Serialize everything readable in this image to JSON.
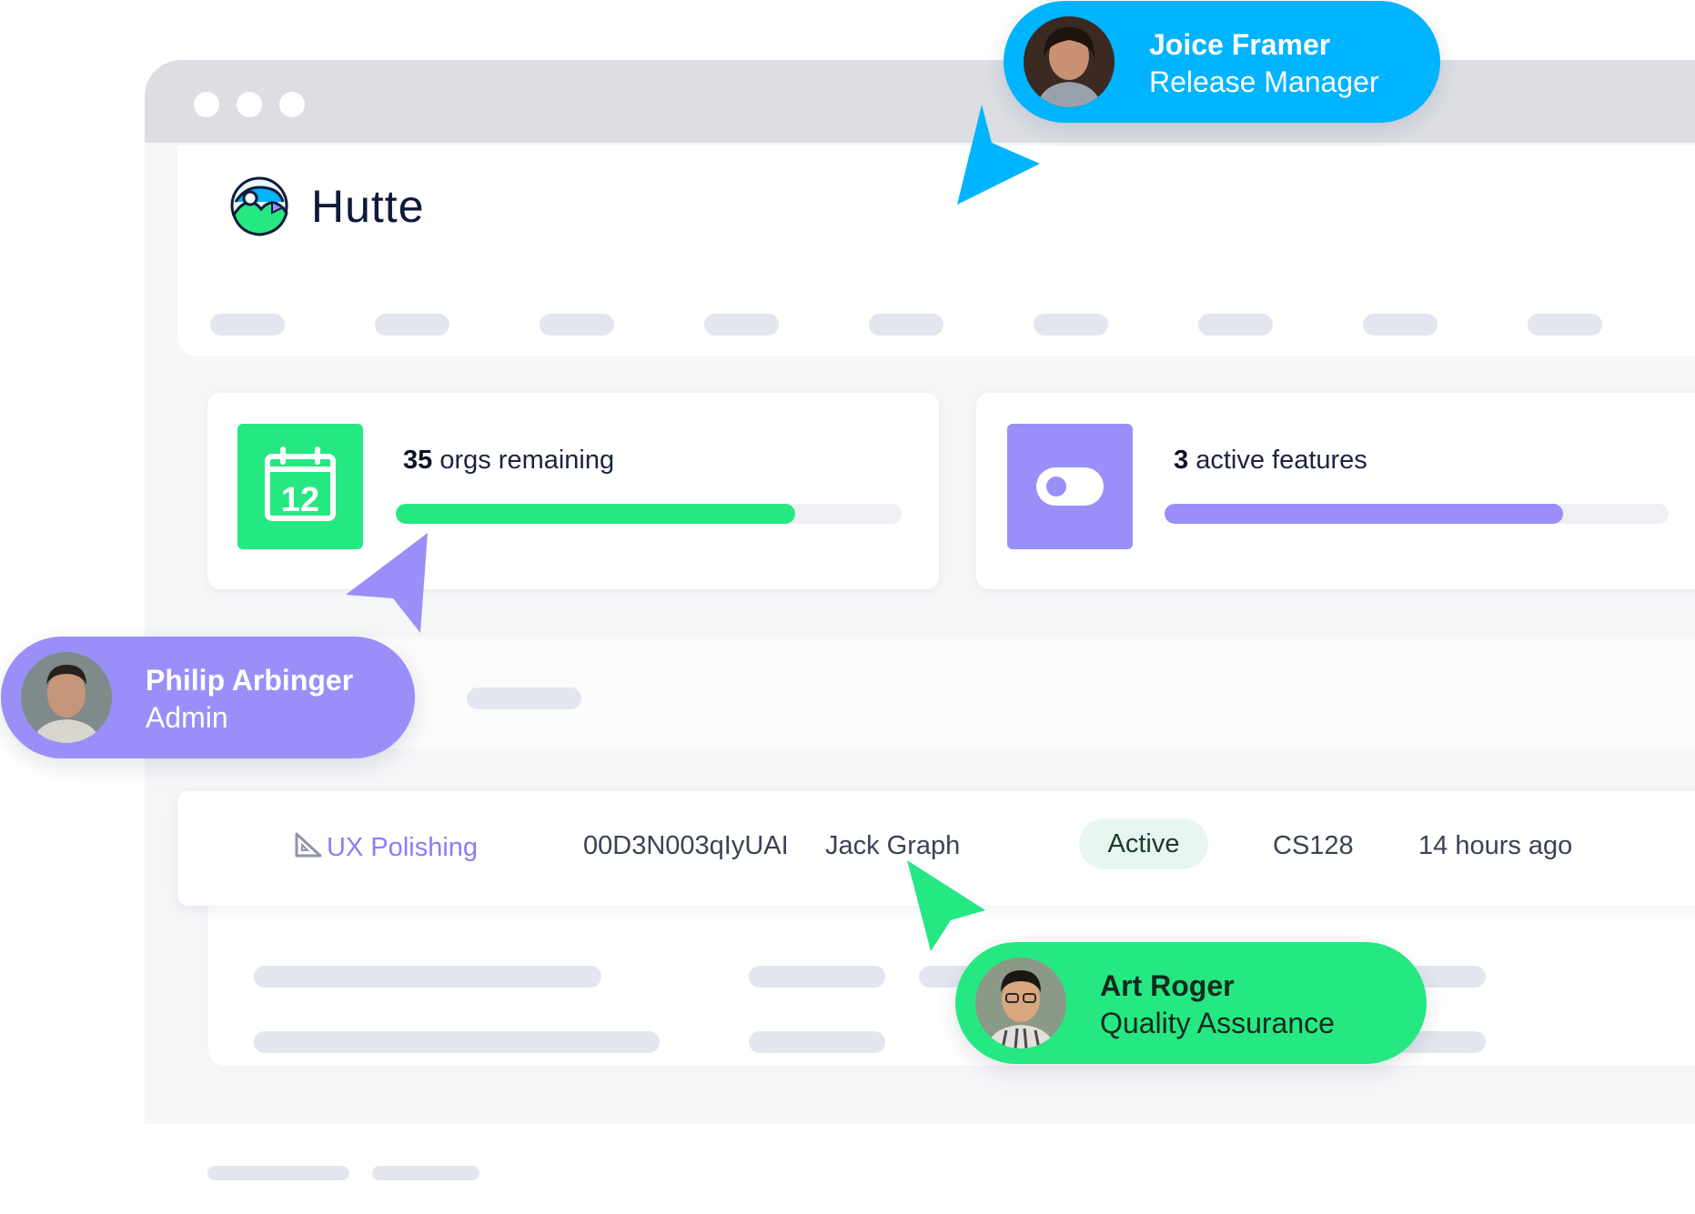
{
  "app": {
    "brand": "Hutte"
  },
  "colors": {
    "green": "#26e882",
    "purple": "#9a8ff9",
    "blue": "#00b4ff",
    "window_bar": "#dcdee4"
  },
  "stats": [
    {
      "count": "35",
      "label": " orgs remaining",
      "icon": "calendar-icon",
      "icon_text": "12",
      "progress": 0.79,
      "color": "#26e882"
    },
    {
      "count": "3",
      "label": " active features",
      "icon": "toggle-icon",
      "progress": 0.79,
      "color": "#9a8ff9"
    }
  ],
  "row": {
    "project_icon": "triangle-ruler-icon",
    "project": "UX Polishing",
    "org_id": "00D3N003qIyUAI",
    "owner": "Jack Graph",
    "status": "Active",
    "code": "CS128",
    "updated": "14 hours ago"
  },
  "users": [
    {
      "name": "Joice Framer",
      "role": "Release Manager",
      "color": "#00b4ff"
    },
    {
      "name": "Philip Arbinger",
      "role": "Admin",
      "color": "#9a8ff9"
    },
    {
      "name": "Art Roger",
      "role": "Quality Assurance",
      "color": "#26e882"
    }
  ]
}
